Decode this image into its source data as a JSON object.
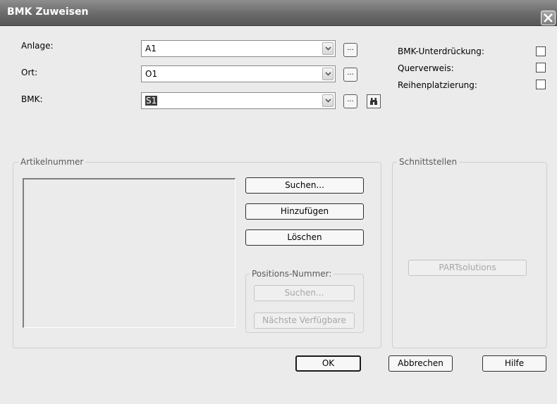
{
  "window": {
    "title": "BMK Zuweisen"
  },
  "fields": {
    "anlage": {
      "label": "Anlage:",
      "value": "A1"
    },
    "ort": {
      "label": "Ort:",
      "value": "O1"
    },
    "bmk": {
      "label": "BMK:",
      "value": "S1"
    },
    "browse_label": "..."
  },
  "options": {
    "bmk_unterdrueckung": {
      "label": "BMK-Unterdrückung:",
      "checked": false
    },
    "querverweis": {
      "label": "Querverweis:",
      "checked": false
    },
    "reihenplatzierung": {
      "label": "Reihenplatzierung:",
      "checked": false
    }
  },
  "artikel": {
    "group_label": "Artikelnummer",
    "items": [],
    "buttons": {
      "suchen": "Suchen...",
      "hinzufuegen": "Hinzufügen",
      "loeschen": "Löschen"
    }
  },
  "positions": {
    "group_label": "Positions-Nummer:",
    "buttons": {
      "suchen": "Suchen...",
      "naechste": "Nächste Verfügbare"
    }
  },
  "schnittstellen": {
    "group_label": "Schnittstellen",
    "buttons": {
      "partsolutions": "PARTsolutions"
    }
  },
  "footer": {
    "ok": "OK",
    "abbrechen": "Abbrechen",
    "hilfe": "Hilfe"
  },
  "colors": {
    "titlebar": "#6a6a6a",
    "dialog_bg": "#ebebeb",
    "disabled_text": "#a6a6a6"
  }
}
